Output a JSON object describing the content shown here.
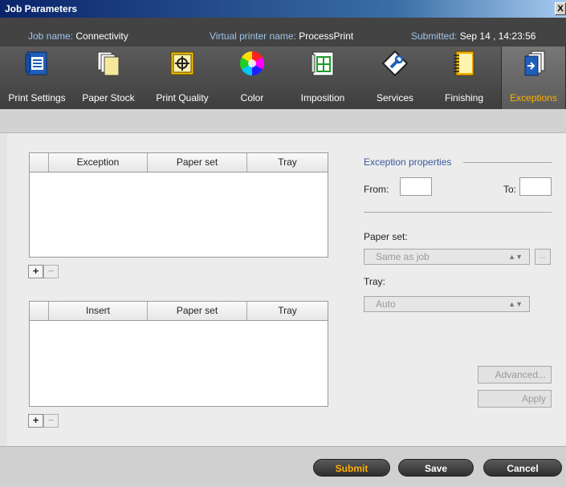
{
  "window": {
    "title": "Job Parameters",
    "close_glyph": "X"
  },
  "info": {
    "job_name_label": "Job name:",
    "job_name": "Connectivity",
    "printer_label": "Virtual printer name:",
    "printer": "ProcessPrint",
    "submitted_label": "Submitted:",
    "submitted": "Sep 14 , 14:23:56"
  },
  "toolbar": {
    "active": "Exceptions",
    "items": [
      {
        "label": "Print Settings",
        "icon": "print-settings-icon"
      },
      {
        "label": "Paper Stock",
        "icon": "paper-stock-icon"
      },
      {
        "label": "Print Quality",
        "icon": "print-quality-icon"
      },
      {
        "label": "Color",
        "icon": "color-wheel-icon"
      },
      {
        "label": "Imposition",
        "icon": "imposition-icon"
      },
      {
        "label": "Services",
        "icon": "services-icon"
      },
      {
        "label": "Finishing",
        "icon": "finishing-icon"
      },
      {
        "label": "Exceptions",
        "icon": "exceptions-icon"
      }
    ]
  },
  "exceptions_table": {
    "columns": [
      "",
      "Exception",
      "Paper set",
      "Tray"
    ],
    "rows": []
  },
  "inserts_table": {
    "columns": [
      "",
      "Insert",
      "Paper set",
      "Tray"
    ],
    "rows": []
  },
  "controls": {
    "add": "+",
    "remove": "−"
  },
  "properties": {
    "title": "Exception properties",
    "from_label": "From:",
    "to_label": "To:",
    "from_value": "",
    "to_value": "",
    "paper_set_label": "Paper set:",
    "paper_set_value": "Same as job",
    "tray_label": "Tray:",
    "tray_value": "Auto",
    "browse_label": "...",
    "advanced_label": "Advanced...",
    "apply_label": "Apply"
  },
  "footer": {
    "submit": "Submit",
    "save": "Save",
    "cancel": "Cancel"
  },
  "colors": {
    "accent": "#ffb000",
    "section_title": "#3a5a9a"
  }
}
